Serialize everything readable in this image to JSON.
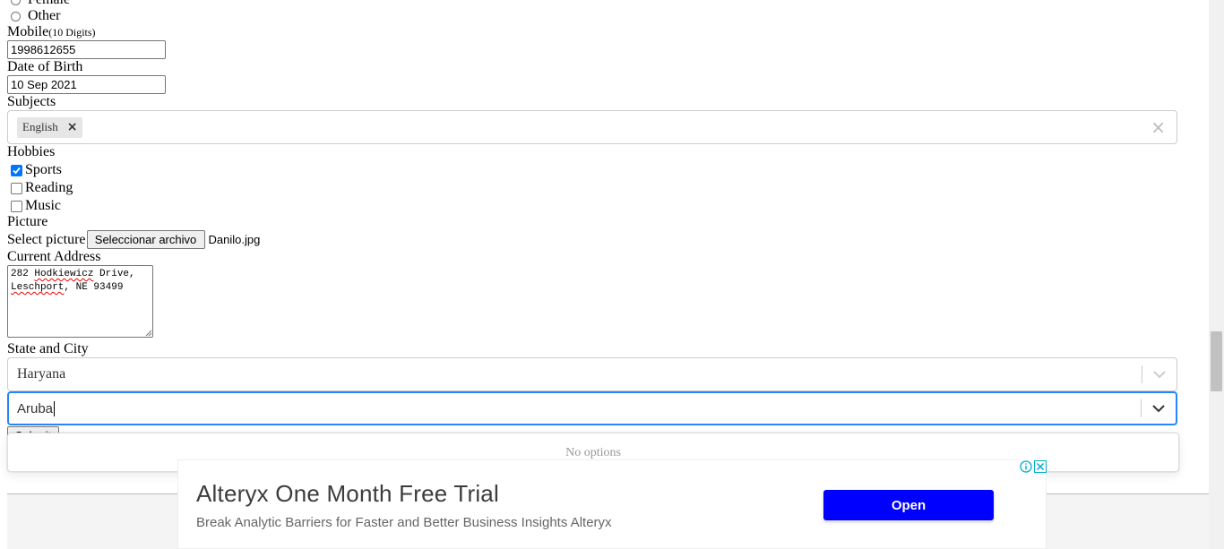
{
  "form": {
    "gender": {
      "options": [
        "Female",
        "Other"
      ]
    },
    "mobile": {
      "label": "Mobile",
      "hint": "(10 Digits)",
      "value": "1998612655"
    },
    "dob": {
      "label": "Date of Birth",
      "value": "10 Sep 2021"
    },
    "subjects": {
      "label": "Subjects",
      "chips": [
        "English"
      ],
      "remove_glyph": "×",
      "clear_glyph": "×"
    },
    "hobbies": {
      "label": "Hobbies",
      "items": [
        {
          "label": "Sports",
          "checked": true
        },
        {
          "label": "Reading",
          "checked": false
        },
        {
          "label": "Music",
          "checked": false
        }
      ]
    },
    "picture": {
      "label": "Picture",
      "prompt": "Select picture",
      "button": "Seleccionar archivo",
      "filename": "Danilo.jpg"
    },
    "address": {
      "label": "Current Address",
      "line1_a": "282 ",
      "line1_b": "Hodkiewicz",
      "line1_c": " Drive,",
      "line2_a": "Leschport",
      "line2_b": ", NE 93499"
    },
    "state_city": {
      "label": "State and City",
      "state_value": "Haryana",
      "city_value": "Aruba"
    },
    "submit_partial": "Submit",
    "dropdown": {
      "message": "No options"
    }
  },
  "ad": {
    "title": "Alteryx One Month Free Trial",
    "description": "Break Analytic Barriers for Faster and Better Business Insights Alteryx",
    "button": "Open",
    "info_icon": "info-icon",
    "close_icon": "close-icon",
    "button_color": "#0000ff"
  },
  "colors": {
    "focus": "#2684ff",
    "checkbox": "#0075ff"
  }
}
